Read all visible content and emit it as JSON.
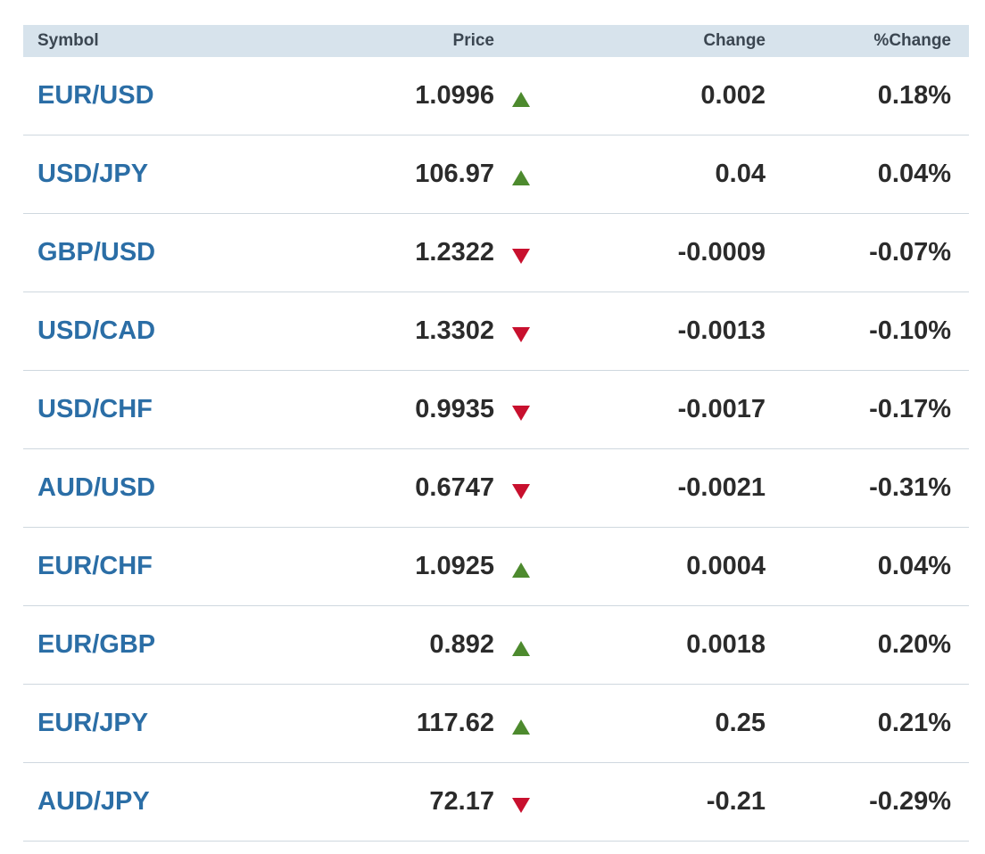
{
  "columns": {
    "symbol": "Symbol",
    "price": "Price",
    "change": "Change",
    "pct_change": "%Change"
  },
  "colors": {
    "header_bg": "#d7e3ec",
    "symbol_link": "#2b6ea6",
    "up": "#4d8a2e",
    "down": "#c8102e",
    "row_divider": "#cfd8df"
  },
  "icons": {
    "up": "triangle-up-icon",
    "down": "triangle-down-icon"
  },
  "rows": [
    {
      "symbol": "EUR/USD",
      "price": "1.0996",
      "direction": "up",
      "change": "0.002",
      "pct_change": "0.18%"
    },
    {
      "symbol": "USD/JPY",
      "price": "106.97",
      "direction": "up",
      "change": "0.04",
      "pct_change": "0.04%"
    },
    {
      "symbol": "GBP/USD",
      "price": "1.2322",
      "direction": "down",
      "change": "-0.0009",
      "pct_change": "-0.07%"
    },
    {
      "symbol": "USD/CAD",
      "price": "1.3302",
      "direction": "down",
      "change": "-0.0013",
      "pct_change": "-0.10%"
    },
    {
      "symbol": "USD/CHF",
      "price": "0.9935",
      "direction": "down",
      "change": "-0.0017",
      "pct_change": "-0.17%"
    },
    {
      "symbol": "AUD/USD",
      "price": "0.6747",
      "direction": "down",
      "change": "-0.0021",
      "pct_change": "-0.31%"
    },
    {
      "symbol": "EUR/CHF",
      "price": "1.0925",
      "direction": "up",
      "change": "0.0004",
      "pct_change": "0.04%"
    },
    {
      "symbol": "EUR/GBP",
      "price": "0.892",
      "direction": "up",
      "change": "0.0018",
      "pct_change": "0.20%"
    },
    {
      "symbol": "EUR/JPY",
      "price": "117.62",
      "direction": "up",
      "change": "0.25",
      "pct_change": "0.21%"
    },
    {
      "symbol": "AUD/JPY",
      "price": "72.17",
      "direction": "down",
      "change": "-0.21",
      "pct_change": "-0.29%"
    }
  ]
}
